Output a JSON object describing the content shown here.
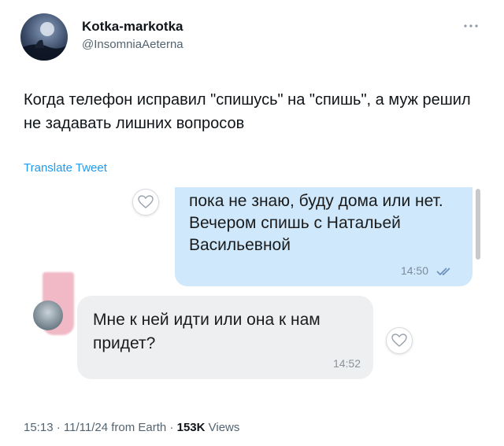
{
  "author": {
    "display_name": "Kotka-markotka",
    "handle": "@InsomniaAeterna"
  },
  "tweet": {
    "text": "Когда телефон исправил \"спишусь\" на \"спишь\", а муж решил не задавать лишних вопросов",
    "translate_label": "Translate Tweet"
  },
  "chat": {
    "outgoing": {
      "text": "пока не знаю, буду дома или нет. Вечером спишь с Натальей Васильевной",
      "time": "14:50"
    },
    "incoming": {
      "text": "Мне к ней идти или она к нам придет?",
      "time": "14:52"
    }
  },
  "meta": {
    "time": "15:13",
    "date": "11/11/24",
    "source": "from Earth",
    "views_count": "153K",
    "views_label": "Views",
    "separator": "·"
  },
  "colors": {
    "accent": "#1d9bf0",
    "outgoing_bubble": "#cfe8fb",
    "incoming_bubble": "#eeeff1"
  }
}
